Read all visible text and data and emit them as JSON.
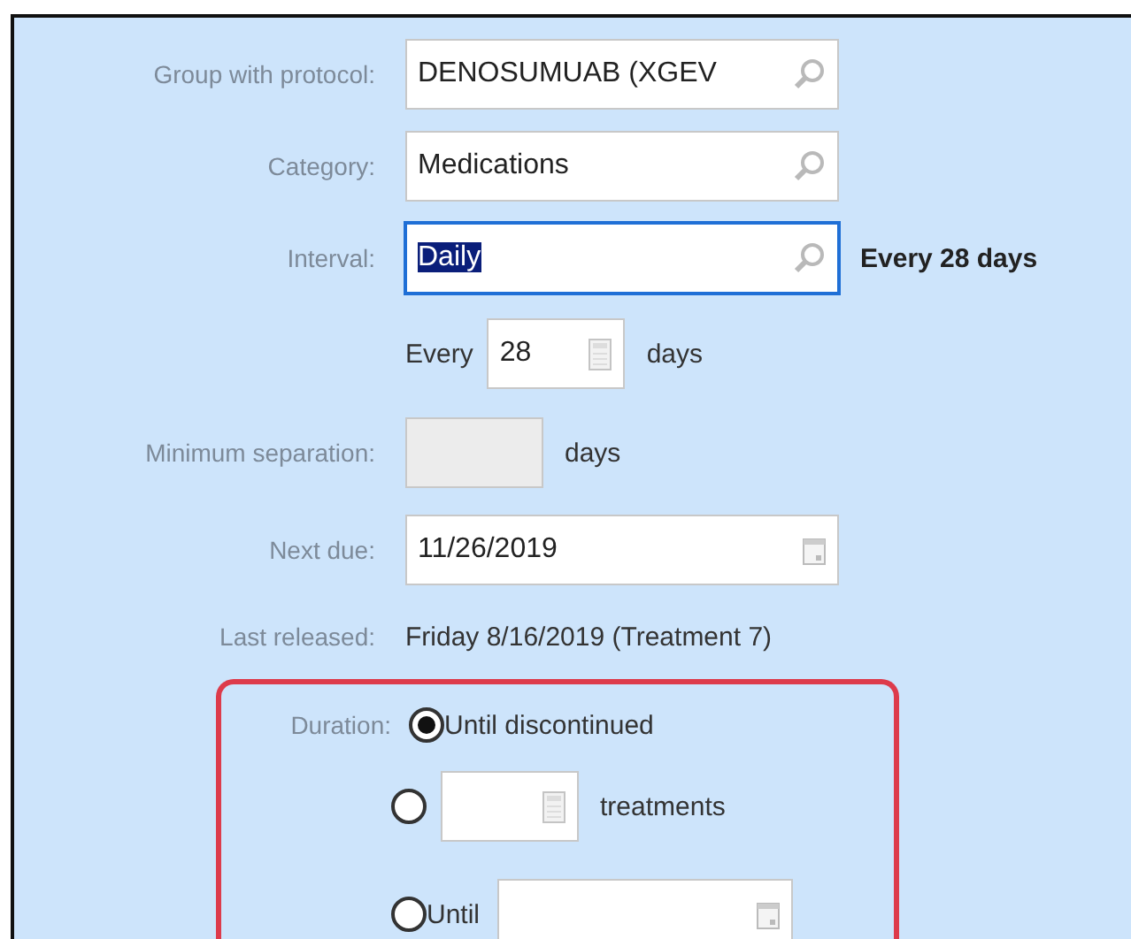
{
  "fields": [
    {
      "kind": "lookup",
      "label": "Group with protocol:",
      "value": "DENOSUMUAB (XGEV",
      "focused": false,
      "selected_text": false
    },
    {
      "kind": "lookup",
      "label": "Category:",
      "value": "Medications",
      "focused": false,
      "selected_text": false
    },
    {
      "kind": "lookup",
      "label": "Interval:",
      "value": "Daily",
      "focused": true,
      "selected_text": true,
      "summary": "Every 28 days"
    },
    {
      "kind": "every",
      "prefix": "Every",
      "value": "28",
      "suffix": "days"
    },
    {
      "kind": "number",
      "label": "Minimum separation:",
      "disabled": true,
      "suffix": "days"
    },
    {
      "kind": "date",
      "label": "Next due:",
      "value": "11/26/2019"
    },
    {
      "kind": "text",
      "label": "Last released:",
      "value": "Friday 8/16/2019 (Treatment 7)"
    }
  ],
  "duration": {
    "label": "Duration:",
    "options": [
      {
        "kind": "plain",
        "text": "Until discontinued",
        "selected": true
      },
      {
        "kind": "count",
        "suffix": "treatments",
        "selected": false
      },
      {
        "kind": "until",
        "text": "Until",
        "selected": false
      }
    ]
  }
}
